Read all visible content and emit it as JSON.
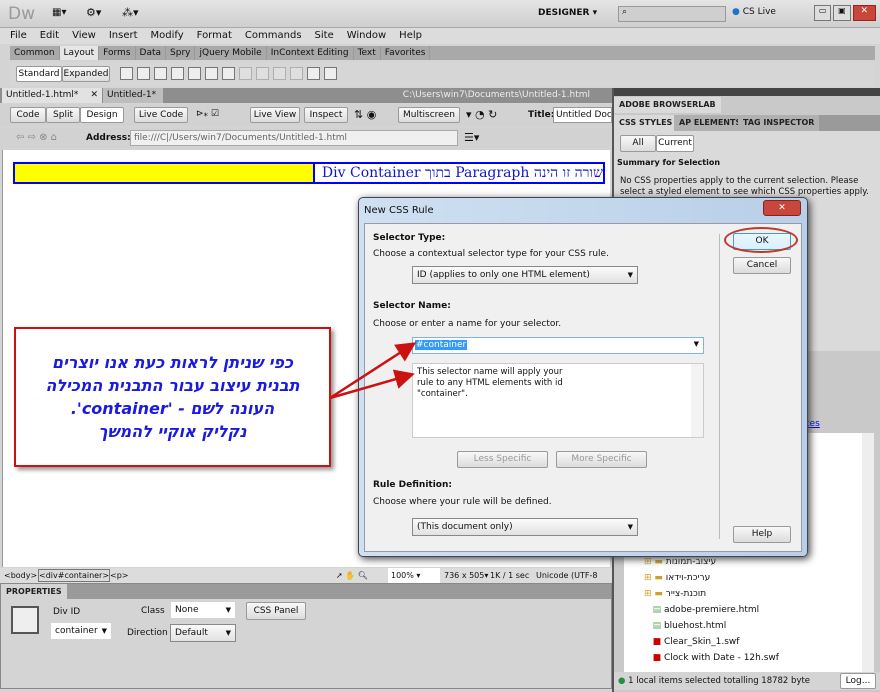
{
  "app": {
    "logo": "Dw",
    "workspace": "DESIGNER",
    "cs_live": "CS Live"
  },
  "menu": [
    "File",
    "Edit",
    "View",
    "Insert",
    "Modify",
    "Format",
    "Commands",
    "Site",
    "Window",
    "Help"
  ],
  "insert_tabs": [
    "Common",
    "Layout",
    "Forms",
    "Data",
    "Spry",
    "jQuery Mobile",
    "InContext Editing",
    "Text",
    "Favorites"
  ],
  "insert_modes": [
    "Standard",
    "Expanded"
  ],
  "doc_tabs": [
    {
      "label": "Untitled-1.html*"
    },
    {
      "label": "Untitled-1*"
    }
  ],
  "doc_path": "C:\\Users\\win7\\Documents\\Untitled-1.html",
  "doc_toolbar": {
    "code": "Code",
    "split": "Split",
    "design": "Design",
    "live_code": "Live Code",
    "live_view": "Live View",
    "inspect": "Inspect",
    "multiscreen": "Multiscreen",
    "title_label": "Title:",
    "title_value": "Untitled Document"
  },
  "address": {
    "label": "Address:",
    "value": "file:///C|/Users/win7/Documents/Untitled-1.html"
  },
  "page": {
    "paragraph": "שורה זו הינה Paragraph בתוך Div Container",
    "highlight": "#ffff00",
    "border": "#0000ff"
  },
  "callout": {
    "lines": [
      "כפי שניתן לראות כעת אנו יוצרים",
      "תבנית עיצוב עבור התבנית המכילה",
      "העונה לשם - 'container'.",
      "נקליק אוקיי להמשך"
    ],
    "color": "#1a1adf",
    "border": "#cc1111"
  },
  "dialog": {
    "title": "New CSS Rule",
    "selector_type_heading": "Selector Type:",
    "selector_type_desc": "Choose a contextual selector type for your CSS rule.",
    "selector_type_value": "ID (applies to only one HTML element)",
    "selector_name_heading": "Selector Name:",
    "selector_name_desc": "Choose or enter a name for your selector.",
    "selector_name_value": "#container",
    "description": "This selector name will apply your rule to any HTML elements with id \"container\".",
    "less_specific": "Less Specific",
    "more_specific": "More Specific",
    "rule_def_heading": "Rule Definition:",
    "rule_def_desc": "Choose where your rule will be defined.",
    "rule_def_value": "(This document only)",
    "ok": "OK",
    "cancel": "Cancel",
    "help": "Help"
  },
  "status": {
    "tags": [
      "<body>",
      "<div#container>",
      "<p>"
    ],
    "zoom": "100%",
    "size": "736 x 505",
    "download": "1K / 1 sec",
    "encoding": "Unicode (UTF-8"
  },
  "properties": {
    "tab": "PROPERTIES",
    "div_id_label": "Div ID",
    "div_id_value": "container",
    "class_label": "Class",
    "class_value": "None",
    "direction_label": "Direction",
    "direction_value": "Default",
    "css_panel": "CSS Panel"
  },
  "right": {
    "browserlab": "ADOBE BROWSERLAB",
    "tabs": [
      "CSS STYLES",
      "AP ELEMENTS",
      "TAG INSPECTOR"
    ],
    "all": "All",
    "current": "Current",
    "summary": "Summary for Selection",
    "summary_text": "No CSS properties apply to the current selection.  Please select a styled element to see which CSS properties apply.",
    "link": "tes",
    "files": [
      {
        "name": "עיצוב-תמונות",
        "type": "folder"
      },
      {
        "name": "עריכת-וידאו",
        "type": "folder"
      },
      {
        "name": "תוכנת-צייר",
        "type": "folder"
      },
      {
        "name": "adobe-premiere.html",
        "type": "html"
      },
      {
        "name": "bluehost.html",
        "type": "html"
      },
      {
        "name": "Clear_Skin_1.swf",
        "type": "swf"
      },
      {
        "name": "Clock with Date - 12h.swf",
        "type": "swf"
      }
    ],
    "footer": "1 local items selected totalling 18782 byte",
    "log": "Log..."
  }
}
